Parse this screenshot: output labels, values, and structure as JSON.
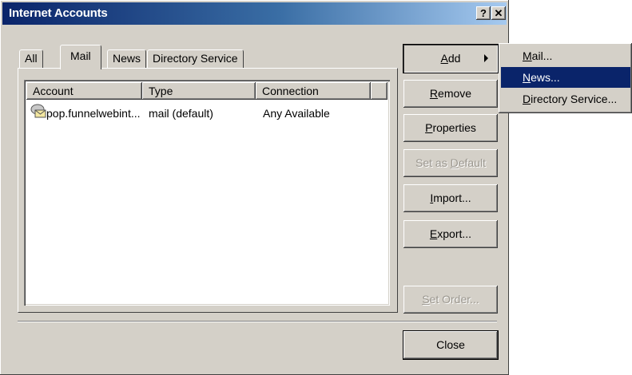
{
  "window": {
    "title": "Internet Accounts",
    "help_glyph": "?",
    "close_glyph": "✕"
  },
  "tabs": [
    {
      "label": "All",
      "active": false
    },
    {
      "label": "Mail",
      "active": true
    },
    {
      "label": "News",
      "active": false
    },
    {
      "label": "Directory Service",
      "active": false
    }
  ],
  "list": {
    "columns": [
      "Account",
      "Type",
      "Connection"
    ],
    "rows": [
      {
        "icon": "mail-account-icon",
        "account": "pop.funnelwebint...",
        "type": "mail (default)",
        "connection": "Any Available",
        "selected": false
      }
    ]
  },
  "buttons": {
    "add": {
      "pre": "",
      "key": "A",
      "post": "dd"
    },
    "remove": {
      "pre": "",
      "key": "R",
      "post": "emove"
    },
    "properties": {
      "pre": "",
      "key": "P",
      "post": "roperties"
    },
    "set_default": {
      "pre": "Set as ",
      "key": "D",
      "post": "efault"
    },
    "import": {
      "pre": "",
      "key": "I",
      "post": "mport..."
    },
    "export": {
      "pre": "",
      "key": "E",
      "post": "xport..."
    },
    "set_order": {
      "pre": "",
      "key": "S",
      "post": "et Order..."
    },
    "close": "Close"
  },
  "add_menu": [
    {
      "pre": "",
      "key": "M",
      "post": "ail...",
      "highlighted": false
    },
    {
      "pre": "",
      "key": "N",
      "post": "ews...",
      "highlighted": true
    },
    {
      "pre": "",
      "key": "D",
      "post": "irectory Service...",
      "highlighted": false
    }
  ],
  "colors": {
    "titlebar_start": "#0a246a",
    "titlebar_end": "#a6caf0",
    "face": "#d4d0c8",
    "highlight": "#0a246a"
  }
}
